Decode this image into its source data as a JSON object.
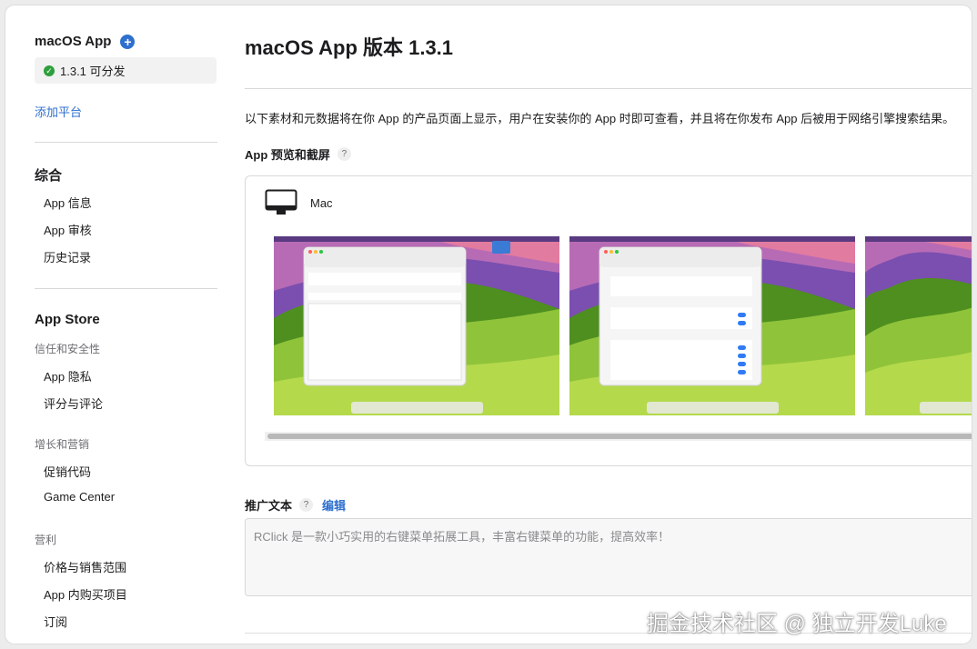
{
  "sidebar": {
    "app_name": "macOS App",
    "add_icon": "plus-circle-icon",
    "version_status": "1.3.1 可分发",
    "status_icon": "checkmark-circle-icon",
    "add_platform": "添加平台",
    "general": {
      "title": "综合",
      "items": [
        "App 信息",
        "App 审核",
        "历史记录"
      ]
    },
    "app_store": {
      "title": "App Store",
      "trust_title": "信任和安全性",
      "trust_items": [
        "App 隐私",
        "评分与评论"
      ],
      "growth_title": "增长和营销",
      "growth_items": [
        "促销代码",
        "Game Center"
      ],
      "monetization_title": "营利",
      "monetization_items": [
        "价格与销售范围",
        "App 内购买项目",
        "订阅"
      ]
    }
  },
  "main": {
    "title": "macOS App 版本 1.3.1",
    "intro": "以下素材和元数据将在你 App 的产品页面上显示，用户在安装你的 App 时即可查看，并且将在你发布 App 后被用于网络引擎搜索结果。",
    "previews_label": "App 预览和截屏",
    "help_icon": "question-mark-icon",
    "help_glyph": "?",
    "platform_label": "Mac",
    "platform_icon": "desktop-monitor-icon",
    "promo_label": "推广文本",
    "edit_label": "编辑",
    "promo_text": "RClick 是一款小巧实用的右键菜单拓展工具，丰富右键菜单的功能，提高效率！"
  },
  "watermark": "掘金技术社区 @ 独立开发Luke",
  "colors": {
    "accent": "#2f6fce",
    "status_green": "#2d9f3c",
    "wallpaper_green": "#4e8f1f"
  }
}
